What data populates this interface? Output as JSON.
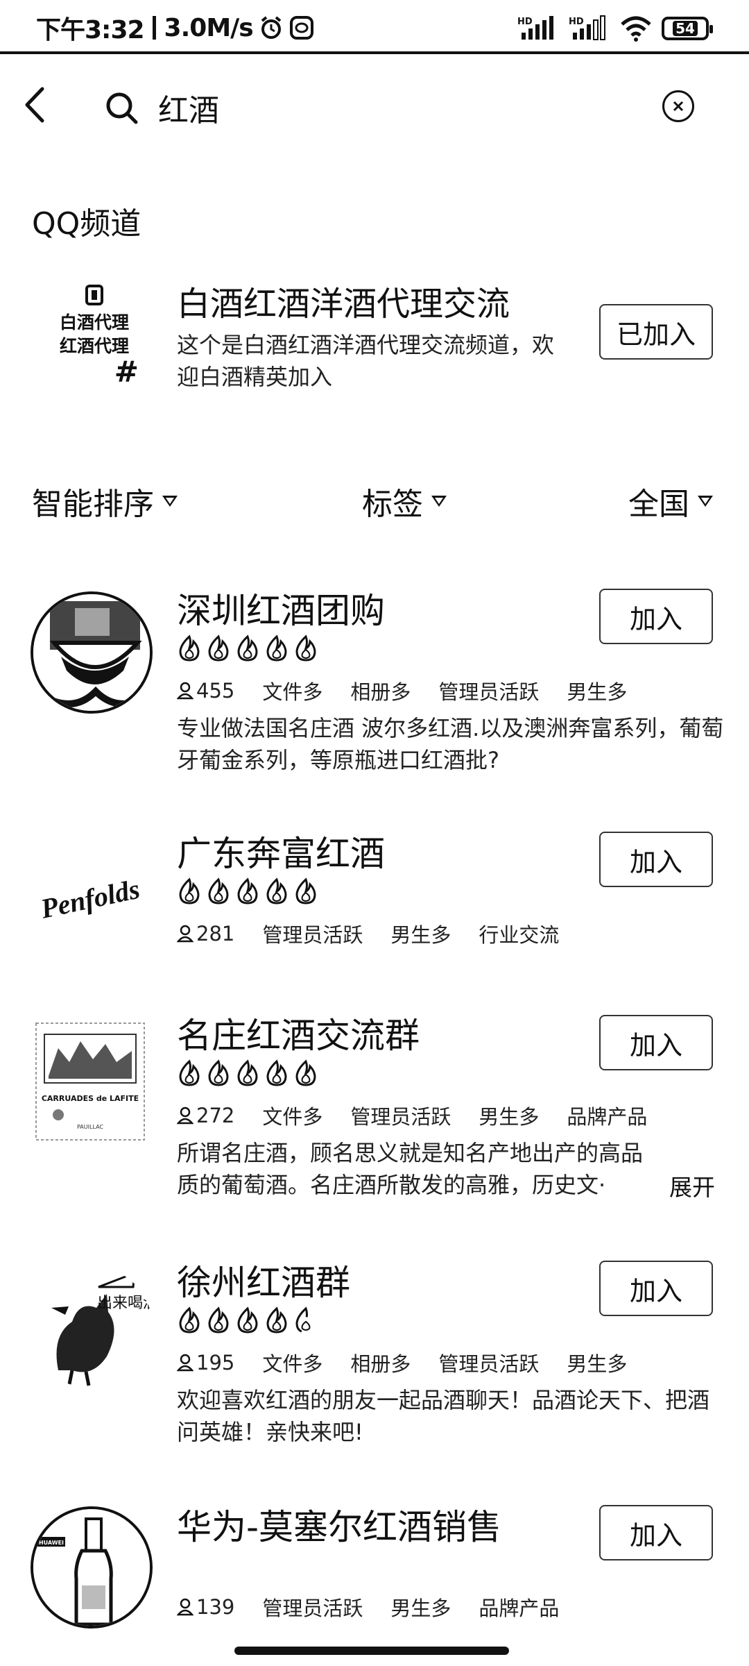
{
  "status_bar": {
    "time": "下午3:32",
    "speed": "3.0M/s",
    "battery": "54"
  },
  "search": {
    "query": "红酒",
    "clear_icon": "clear-icon",
    "back_icon": "chevron-left-icon",
    "search_icon": "search-icon"
  },
  "channel_section": {
    "title": "QQ频道",
    "channel": {
      "logo_line1": "白酒代理",
      "logo_line2": "红酒代理",
      "logo_hash": "#",
      "name": "白酒红酒洋酒代理交流",
      "desc": "这个是白酒红酒洋酒代理交流频道，欢迎白酒精英加入",
      "button": "已加入"
    }
  },
  "filters": {
    "sort": "智能排序",
    "tags": "标签",
    "region": "全国"
  },
  "groups": [
    {
      "name": "深圳红酒团购",
      "flames": 5,
      "members": "455",
      "tags": [
        "文件多",
        "相册多",
        "管理员活跃",
        "男生多"
      ],
      "desc": "专业做法国名庄酒 波尔多红酒.以及澳洲奔富系列，葡萄牙葡金系列，等原瓶进口红酒批?",
      "button": "加入"
    },
    {
      "name": "广东奔富红酒",
      "flames": 5,
      "members": "281",
      "tags": [
        "管理员活跃",
        "男生多",
        "行业交流"
      ],
      "desc": "",
      "logo_text": "Penfolds",
      "button": "加入"
    },
    {
      "name": "名庄红酒交流群",
      "flames": 5,
      "members": "272",
      "tags": [
        "文件多",
        "管理员活跃",
        "男生多",
        "品牌产品"
      ],
      "desc": "所谓名庄酒，顾名思义就是知名产地出产的高品质的葡萄酒。名庄酒所散发的高雅，历史文·",
      "expand": "展开",
      "logo_text": "CARRUADES de LAFITE",
      "logo_subtext": "PAUILLAC",
      "button": "加入"
    },
    {
      "name": "徐州红酒群",
      "flames": 4.5,
      "members": "195",
      "tags": [
        "文件多",
        "相册多",
        "管理员活跃",
        "男生多"
      ],
      "desc": "欢迎喜欢红酒的朋友一起品酒聊天！品酒论天下、把酒问英雄！亲快来吧!",
      "logo_text": "出来喝酒",
      "button": "加入"
    },
    {
      "name": "华为-莫塞尔红酒销售",
      "flames": 0,
      "members": "139",
      "tags": [
        "管理员活跃",
        "男生多",
        "品牌产品"
      ],
      "desc": "",
      "logo_text": "HUAWEI",
      "button": "加入"
    }
  ]
}
